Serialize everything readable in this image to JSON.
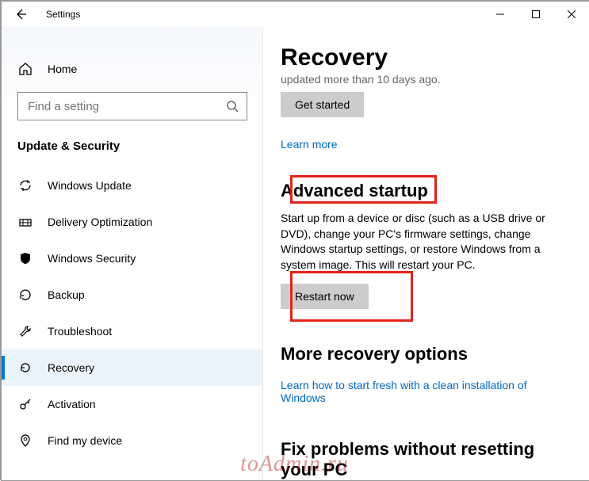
{
  "window": {
    "title": "Settings"
  },
  "sidebar": {
    "home": "Home",
    "search_placeholder": "Find a setting",
    "section": "Update & Security",
    "items": [
      {
        "label": "Windows Update"
      },
      {
        "label": "Delivery Optimization"
      },
      {
        "label": "Windows Security"
      },
      {
        "label": "Backup"
      },
      {
        "label": "Troubleshoot"
      },
      {
        "label": "Recovery"
      },
      {
        "label": "Activation"
      },
      {
        "label": "Find my device"
      }
    ]
  },
  "content": {
    "page_title": "Recovery",
    "truncated_line": "updated more than 10 days ago.",
    "get_started": "Get started",
    "learn_more": "Learn more",
    "adv_heading": "Advanced startup",
    "adv_desc": "Start up from a device or disc (such as a USB drive or DVD), change your PC's firmware settings, change Windows startup settings, or restore Windows from a system image. This will restart your PC.",
    "restart_now": "Restart now",
    "more_heading": "More recovery options",
    "fresh_link": "Learn how to start fresh with a clean installation of Windows",
    "fix_heading": "Fix problems without resetting your PC"
  },
  "watermark": "toAdmin.ru"
}
